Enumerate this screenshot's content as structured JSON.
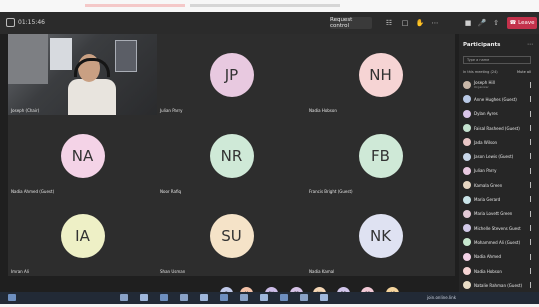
{
  "window": {
    "timer": "01:15:46"
  },
  "toolbar": {
    "request_control": "Request control",
    "leave": "Leave",
    "icons": [
      "people-icon",
      "chat-icon",
      "raise-hand-icon",
      "more-icon",
      "camera-icon",
      "mic-icon",
      "share-icon"
    ]
  },
  "tiles": [
    {
      "kind": "video",
      "name": "Joseph (Chair)"
    },
    {
      "initials": "JP",
      "color": "#e8c9e0",
      "name": "Julian Parry"
    },
    {
      "initials": "NH",
      "color": "#f6d4d4",
      "name": "Nadia Hobson"
    },
    {
      "initials": "NA",
      "color": "#f4d3e7",
      "name": "Nadia Ahmed (Guest)"
    },
    {
      "initials": "NR",
      "color": "#cfe9d7",
      "name": "Noor Rafiq"
    },
    {
      "initials": "FB",
      "color": "#cfe9d7",
      "name": "Francis Bright (Guest)"
    },
    {
      "initials": "IA",
      "color": "#eef0c6",
      "name": "Imran Ali"
    },
    {
      "initials": "SU",
      "color": "#f5e3c8",
      "name": "Shan Usman"
    },
    {
      "initials": "NK",
      "color": "#dfe2f2",
      "name": "Nadia Kamal"
    }
  ],
  "participants": {
    "title": "Participants",
    "search_placeholder": "Type a name",
    "section_label": "In this meeting (24)",
    "mute_all": "Mute all",
    "list": [
      {
        "name": "Joseph Hill",
        "role": "Organizer",
        "color": "#c8b7a8"
      },
      {
        "name": "Anne Hughes (Guest)",
        "role": "",
        "color": "#b9c9e6"
      },
      {
        "name": "Dylan Ayres",
        "role": "",
        "color": "#d8c4e8"
      },
      {
        "name": "Faisal Rasheed (Guest)",
        "role": "",
        "color": "#c4e2cf"
      },
      {
        "name": "Jada Wilson",
        "role": "",
        "color": "#e8c6c6"
      },
      {
        "name": "Jason Lewis (Guest)",
        "role": "",
        "color": "#c8d6e8"
      },
      {
        "name": "Julian Parry",
        "role": "",
        "color": "#e8c9e0"
      },
      {
        "name": "Kamala Green",
        "role": "",
        "color": "#e6d6c2"
      },
      {
        "name": "Maria Gerard",
        "role": "",
        "color": "#c9e4e8"
      },
      {
        "name": "Maria Lovett Green",
        "role": "",
        "color": "#e3c9d6"
      },
      {
        "name": "Michelle Stevens Guest",
        "role": "",
        "color": "#d2c9e8"
      },
      {
        "name": "Mohammed Ali (Guest)",
        "role": "",
        "color": "#c8e8cf"
      },
      {
        "name": "Nadia Ahmed",
        "role": "",
        "color": "#f4d3e7"
      },
      {
        "name": "Nadia Hobson",
        "role": "",
        "color": "#f6d4d4"
      },
      {
        "name": "Natalie Rahman (Guest)",
        "role": "",
        "color": "#e8dcc6"
      },
      {
        "name": "Noor Khan",
        "role": "",
        "color": "#c6d8e8"
      }
    ]
  },
  "bottom_chips": [
    {
      "text": "B",
      "color": "#bfc8e8"
    },
    {
      "text": "M",
      "color": "#f3c2a8"
    },
    {
      "text": "RH",
      "color": "#cdbde8"
    },
    {
      "text": "SB",
      "color": "#d6c2e6"
    },
    {
      "text": "NH",
      "color": "#f4d6b5"
    },
    {
      "text": "DR",
      "color": "#d0c5ea"
    },
    {
      "text": "SS",
      "color": "#f1c9d6"
    },
    {
      "text": "AS",
      "color": "#f5d49d"
    }
  ],
  "taskbar": {
    "label": "join.online.link"
  }
}
